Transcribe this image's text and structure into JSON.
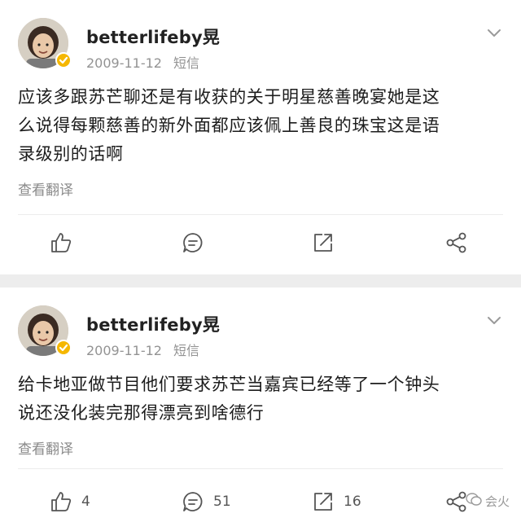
{
  "posts": [
    {
      "author": "betterlifeby晃",
      "date": "2009-11-12",
      "source": "短信",
      "text_lines": [
        "应该多跟苏芒聊还是有收获的关于明星慈善晚宴她是这",
        "么说得每颗慈善的新外面都应该佩上善良的珠宝这是语",
        "录级别的话啊"
      ],
      "translate_label": "查看翻译",
      "actions": {
        "like": "",
        "comment": "",
        "repost": ""
      }
    },
    {
      "author": "betterlifeby晃",
      "date": "2009-11-12",
      "source": "短信",
      "text_lines": [
        "给卡地亚做节目他们要求苏芒当嘉宾已经等了一个钟头",
        "说还没化装完那得漂亮到啥德行"
      ],
      "translate_label": "查看翻译",
      "actions": {
        "like": "4",
        "comment": "51",
        "repost": "16"
      }
    }
  ],
  "watermark": "会火",
  "colors": {
    "verified_badge": "#f5b700",
    "background": "#ededed",
    "icon": "#555555"
  }
}
